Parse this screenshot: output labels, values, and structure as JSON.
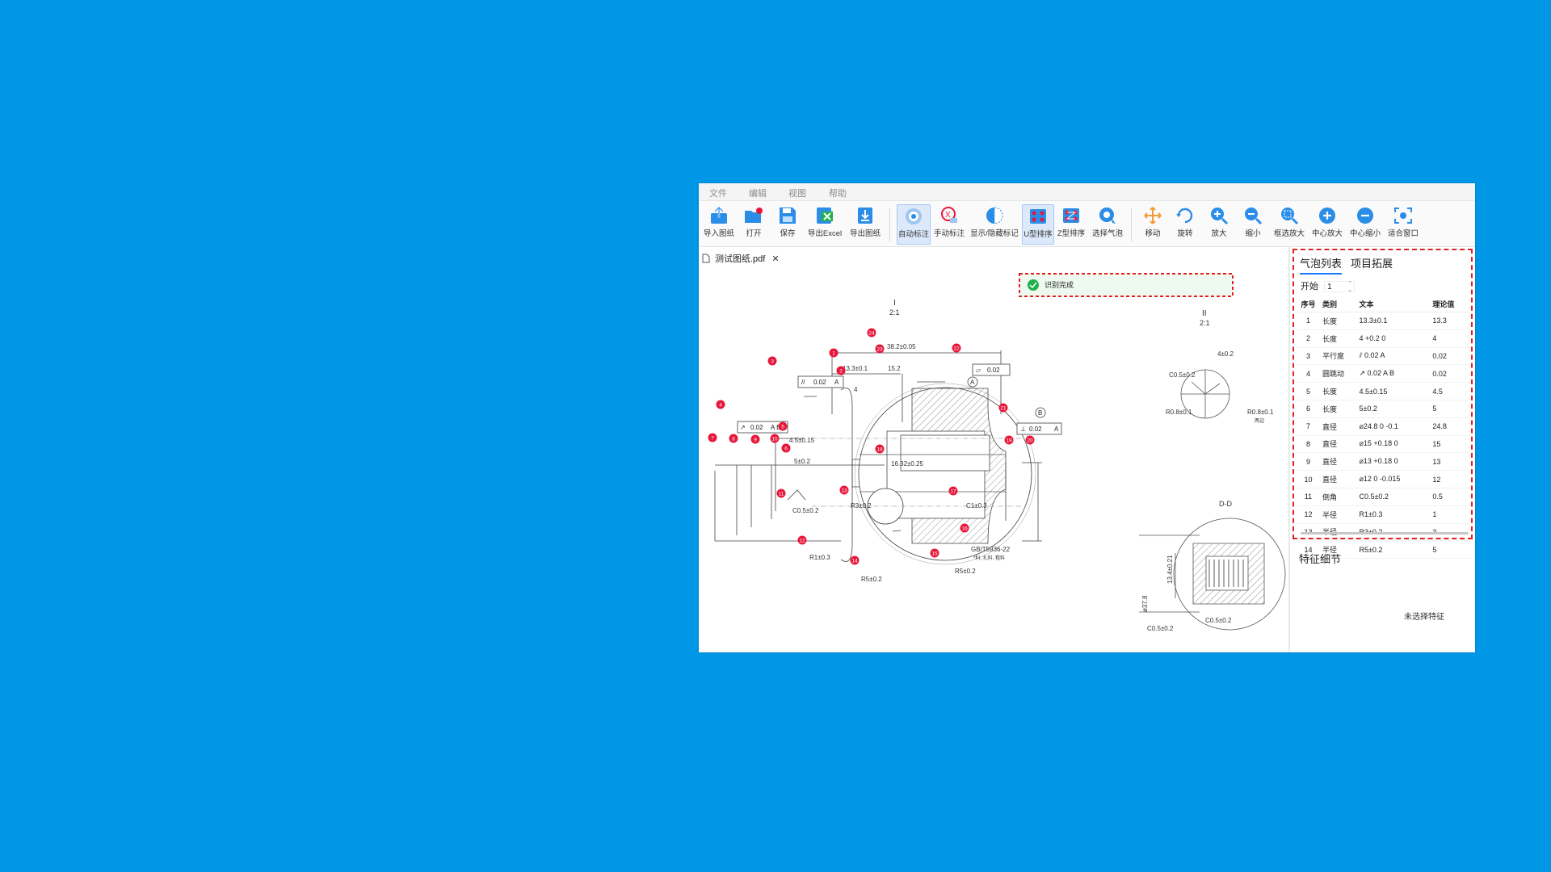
{
  "menu": {
    "file": "文件",
    "edit": "编辑",
    "view": "视图",
    "help": "帮助"
  },
  "toolbar": {
    "import": "导入图纸",
    "open": "打开",
    "save": "保存",
    "export_excel": "导出Excel",
    "export_drawing": "导出图纸",
    "auto_annotate": "自动标注",
    "manual_annotate": "手动标注",
    "toggle_marks": "显示/隐藏标记",
    "u_sort": "U型排序",
    "z_sort": "Z型排序",
    "select_bubble": "选择气泡",
    "move": "移动",
    "rotate": "旋转",
    "zoom_in": "放大",
    "zoom_out": "缩小",
    "box_zoom": "框选放大",
    "center_zoom_in": "中心放大",
    "center_zoom_out": "中心缩小",
    "fit_window": "适合窗口"
  },
  "document": {
    "tab": "测试图纸.pdf",
    "close": "✕"
  },
  "toast": {
    "text": "识别完成"
  },
  "colors": {
    "background": "#0097e6",
    "accent": "#1677ff",
    "bubble": "#e8173a",
    "dashed": "#e02020",
    "success": "#21b04b"
  },
  "drawing": {
    "view1_title": "I",
    "view1_scale": "2:1",
    "view2_title": "II",
    "view2_scale": "2:1",
    "section_title": "D-D",
    "datum_a": "A",
    "datum_b": "B",
    "dims": {
      "d38": "38.2±0.05",
      "d13_3": "13.3±0.1",
      "d15_2": "15.2",
      "d4": "4",
      "d4_5": "4.5±0.15",
      "d5": "5±0.2",
      "d16": "16.32±0.25",
      "c05a": "C0.5±0.2",
      "r3": "R3±0.2",
      "c1": "C1±0.3",
      "r1": "R1±0.3",
      "r5a": "R5±0.2",
      "r5b": "R5±0.2",
      "gb": "GB/T5936-22",
      "gb_note": "*料, 扎料, 粗料",
      "fcf1": "0.02",
      "fcf1d": "A",
      "fcf2": "0.02",
      "fcf2d": "A B",
      "fcf3": "0.02",
      "fcf4": "0.02",
      "fcf4d": "A",
      "v2_c05": "C0.5±0.2",
      "v2_r08a": "R0.8±0.1",
      "v2_r08b": "R0.8±0.1",
      "v2_note": "两边",
      "v2_d4": "4±0.2",
      "dd_c05a": "C0.5±0.2",
      "dd_c05b": "C0.5±0.2",
      "dd_134": "13.4±0.21",
      "dd_37": "ø37.8"
    },
    "bubbles": [
      "1",
      "2",
      "3",
      "4",
      "5",
      "6",
      "7",
      "8",
      "9",
      "10",
      "11",
      "12",
      "13",
      "14",
      "15",
      "16",
      "17",
      "18",
      "19",
      "20",
      "21",
      "22",
      "23",
      "24"
    ]
  },
  "panel": {
    "tab_bubbles": "气泡列表",
    "tab_project": "项目拓展",
    "start_label": "开始",
    "start_value": "1",
    "headers": [
      "序号",
      "类别",
      "文本",
      "理论值"
    ],
    "rows": [
      [
        "1",
        "长度",
        "13.3±0.1",
        "13.3"
      ],
      [
        "2",
        "长度",
        "4 +0.2 0",
        "4"
      ],
      [
        "3",
        "平行度",
        "⫽ 0.02 A",
        "0.02"
      ],
      [
        "4",
        "圆跳动",
        "↗ 0.02 A B",
        "0.02"
      ],
      [
        "5",
        "长度",
        "4.5±0.15",
        "4.5"
      ],
      [
        "6",
        "长度",
        "5±0.2",
        "5"
      ],
      [
        "7",
        "直径",
        "⌀24.8 0 -0.1",
        "24.8"
      ],
      [
        "8",
        "直径",
        "⌀15 +0.18 0",
        "15"
      ],
      [
        "9",
        "直径",
        "⌀13 +0.18 0",
        "13"
      ],
      [
        "10",
        "直径",
        "⌀12 0 -0.015",
        "12"
      ],
      [
        "11",
        "倒角",
        "C0.5±0.2",
        "0.5"
      ],
      [
        "12",
        "半径",
        "R1±0.3",
        "1"
      ],
      [
        "13",
        "半径",
        "R3±0.2",
        "3"
      ],
      [
        "14",
        "半径",
        "R5±0.2",
        "5"
      ]
    ],
    "feature_title": "特征细节",
    "feature_empty": "未选择特征"
  }
}
